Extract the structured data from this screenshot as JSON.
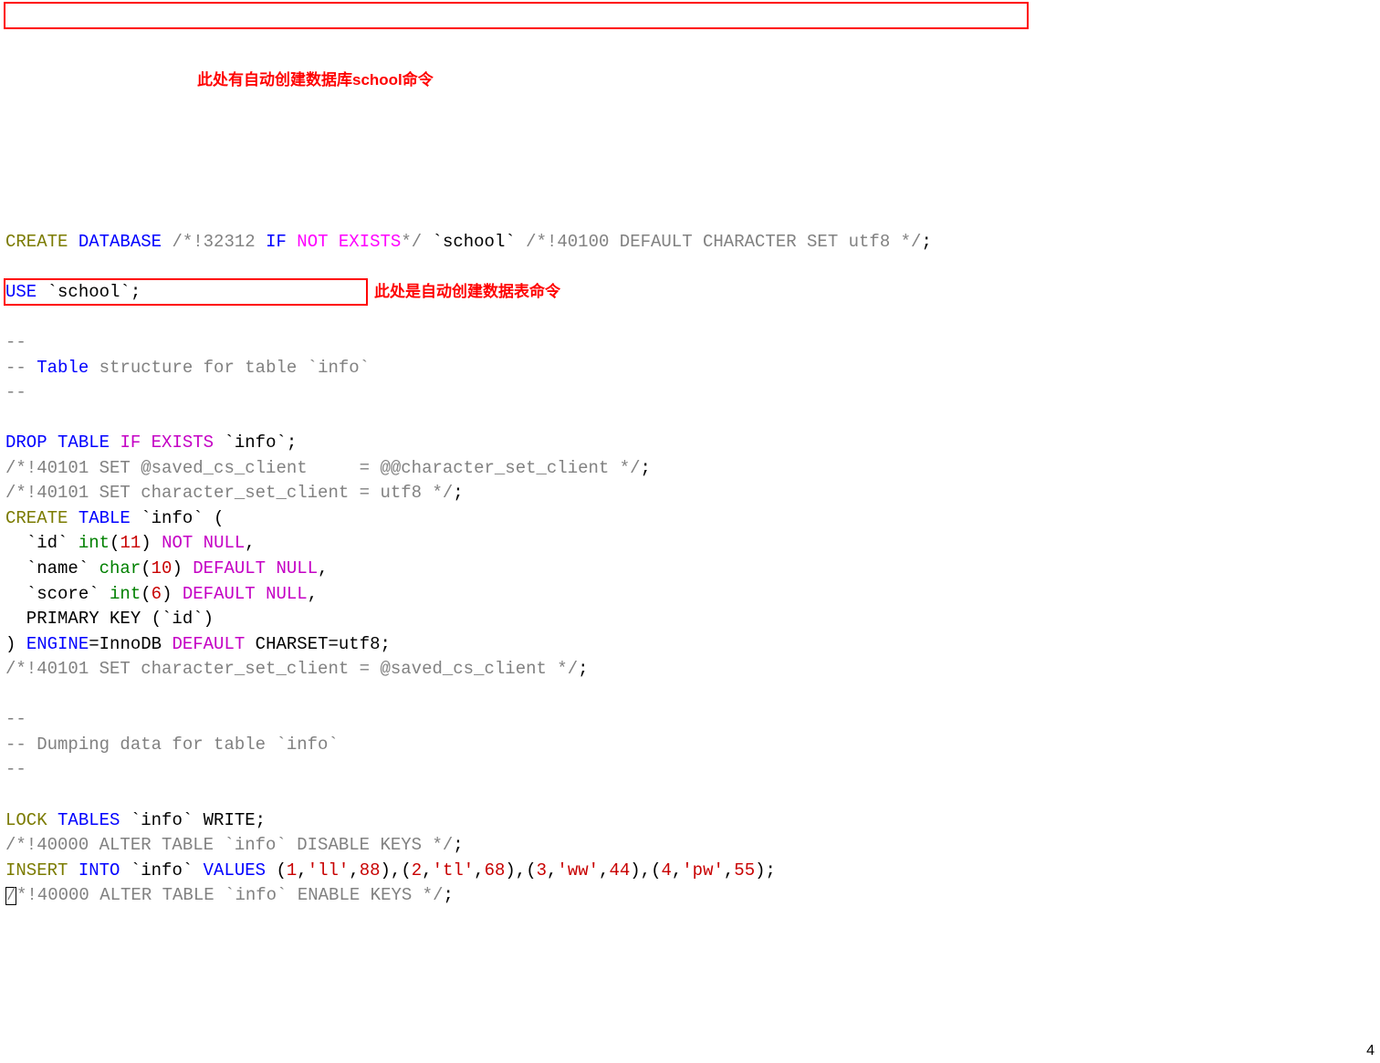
{
  "code": {
    "l1_create": "CREATE",
    "l1_database": "DATABASE",
    "l1_c1a": "/*!32312 ",
    "l1_if": "IF",
    "l1_notexists": "NOT EXISTS",
    "l1_c1b": "*/",
    "l1_school": " `school` ",
    "l1_c2": "/*!40100 DEFAULT CHARACTER SET utf8 */",
    "l1_semi": ";",
    "l3_use": "USE",
    "l3_school": " `school`;",
    "l5_dd": "--",
    "l6a": "-- ",
    "l6_tablestruct": "Table",
    "l6_rest": " structure for table `info`",
    "l7_dd": "--",
    "l9_drop": "DROP",
    "l9_table": "TABLE",
    "l9_ifexists": "IF EXISTS",
    "l9_info": " `info`;",
    "l10_set": "/*!40101 SET @saved_cs_client     = @@character_set_client */",
    "l10_semi": ";",
    "l11_set": "/*!40101 SET character_set_client = utf8 */",
    "l11_semi": ";",
    "l12_create": "CREATE",
    "l12_table": "TABLE",
    "l12_info": " `info` (",
    "l13_col": "  `id` ",
    "l13_int": "int",
    "l13_p1": "(",
    "l13_11": "11",
    "l13_p2": ") ",
    "l13_notnull": "NOT NULL",
    "l13_comma": ",",
    "l14_col": "  `name` ",
    "l14_char": "char",
    "l14_p1": "(",
    "l14_10": "10",
    "l14_p2": ") ",
    "l14_def": "DEFAULT",
    "l14_null": " NULL",
    "l14_comma": ",",
    "l15_col": "  `score` ",
    "l15_int": "int",
    "l15_p1": "(",
    "l15_6": "6",
    "l15_p2": ") ",
    "l15_def": "DEFAULT",
    "l15_null": " NULL",
    "l15_comma": ",",
    "l16_pk": "  PRIMARY KEY (`id`)",
    "l17_close": ") ",
    "l17_engine": "ENGINE",
    "l17_eq": "=InnoDB ",
    "l17_default": "DEFAULT",
    "l17_charset": " CHARSET=utf8;",
    "l18_set": "/*!40101 SET character_set_client = @saved_cs_client */",
    "l18_semi": ";",
    "l20_dd": "--",
    "l21_dump": "-- Dumping data for table `info`",
    "l22_dd": "--",
    "l24_lock": "LOCK",
    "l24_tables": "TABLES",
    "l24_info": " `info` WRITE;",
    "l25_alter": "/*!40000 ALTER TABLE `info` DISABLE KEYS */",
    "l25_semi": ";",
    "l26_insert": "INSERT",
    "l26_into": "INTO",
    "l26_info": " `info` ",
    "l26_values": "VALUES",
    "l26_sp": " ",
    "l26_p1": "(",
    "l26_v1": "1",
    "l26_c": ",",
    "l26_s1": "'ll'",
    "l26_v1b": "88",
    "l26_p2": "(",
    "l26_v2": "2",
    "l26_s2": "'tl'",
    "l26_v2b": "68",
    "l26_p3": "(",
    "l26_v3": "3",
    "l26_s3": "'ww'",
    "l26_v3b": "44",
    "l26_p4": "(",
    "l26_v4": "4",
    "l26_s4": "'pw'",
    "l26_v4b": "55",
    "l26_close": ");",
    "l27_slash": "/",
    "l27_alter": "*!40000 ALTER TABLE `info` ENABLE KEYS */",
    "l27_semi": ";"
  },
  "annotations": {
    "a1": "此处有自动创建数据库school命令",
    "a2": "此处是自动创建数据表命令"
  },
  "page_number": "4"
}
